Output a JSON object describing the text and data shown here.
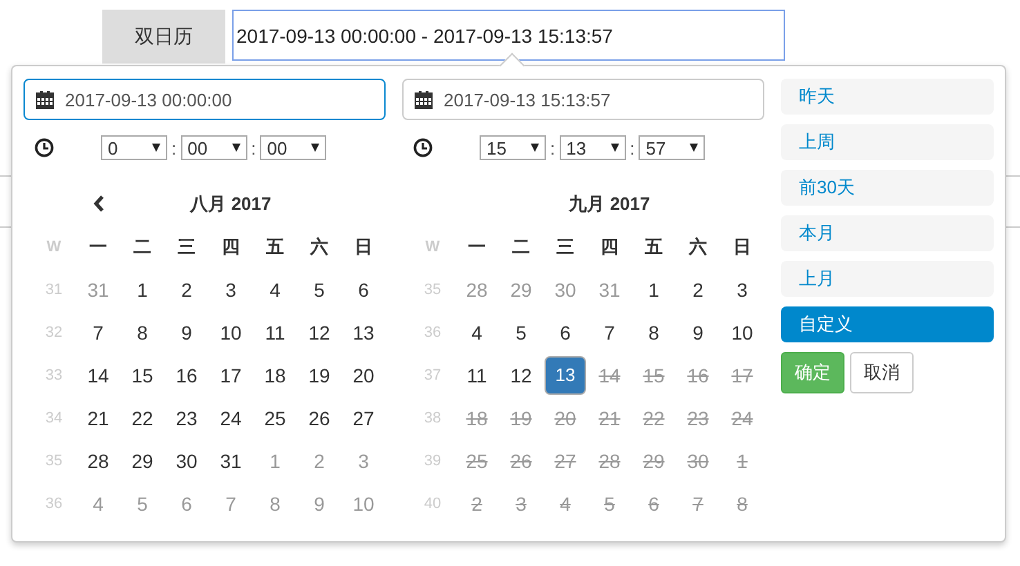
{
  "trigger": {
    "label": "双日历",
    "value": "2017-09-13 00:00:00 - 2017-09-13 15:13:57"
  },
  "calendars": [
    {
      "date_input": {
        "value": "2017-09-13 00:00:00",
        "focused": true
      },
      "time": {
        "hour": "0",
        "minute": "00",
        "second": "00",
        "separator": ":"
      },
      "has_prev": true,
      "month": "八月 2017",
      "week_header": "W",
      "weekdays": [
        "一",
        "二",
        "三",
        "四",
        "五",
        "六",
        "日"
      ],
      "weeks": [
        {
          "number": "31",
          "days": [
            {
              "text": "31",
              "kind": "muted"
            },
            {
              "text": "1",
              "kind": "normal"
            },
            {
              "text": "2",
              "kind": "normal"
            },
            {
              "text": "3",
              "kind": "normal"
            },
            {
              "text": "4",
              "kind": "normal"
            },
            {
              "text": "5",
              "kind": "normal"
            },
            {
              "text": "6",
              "kind": "normal"
            }
          ]
        },
        {
          "number": "32",
          "days": [
            {
              "text": "7",
              "kind": "normal"
            },
            {
              "text": "8",
              "kind": "normal"
            },
            {
              "text": "9",
              "kind": "normal"
            },
            {
              "text": "10",
              "kind": "normal"
            },
            {
              "text": "11",
              "kind": "normal"
            },
            {
              "text": "12",
              "kind": "normal"
            },
            {
              "text": "13",
              "kind": "normal"
            }
          ]
        },
        {
          "number": "33",
          "days": [
            {
              "text": "14",
              "kind": "normal"
            },
            {
              "text": "15",
              "kind": "normal"
            },
            {
              "text": "16",
              "kind": "normal"
            },
            {
              "text": "17",
              "kind": "normal"
            },
            {
              "text": "18",
              "kind": "normal"
            },
            {
              "text": "19",
              "kind": "normal"
            },
            {
              "text": "20",
              "kind": "normal"
            }
          ]
        },
        {
          "number": "34",
          "days": [
            {
              "text": "21",
              "kind": "normal"
            },
            {
              "text": "22",
              "kind": "normal"
            },
            {
              "text": "23",
              "kind": "normal"
            },
            {
              "text": "24",
              "kind": "normal"
            },
            {
              "text": "25",
              "kind": "normal"
            },
            {
              "text": "26",
              "kind": "normal"
            },
            {
              "text": "27",
              "kind": "normal"
            }
          ]
        },
        {
          "number": "35",
          "days": [
            {
              "text": "28",
              "kind": "normal"
            },
            {
              "text": "29",
              "kind": "normal"
            },
            {
              "text": "30",
              "kind": "normal"
            },
            {
              "text": "31",
              "kind": "normal"
            },
            {
              "text": "1",
              "kind": "muted"
            },
            {
              "text": "2",
              "kind": "muted"
            },
            {
              "text": "3",
              "kind": "muted"
            }
          ]
        },
        {
          "number": "36",
          "days": [
            {
              "text": "4",
              "kind": "muted"
            },
            {
              "text": "5",
              "kind": "muted"
            },
            {
              "text": "6",
              "kind": "muted"
            },
            {
              "text": "7",
              "kind": "muted"
            },
            {
              "text": "8",
              "kind": "muted"
            },
            {
              "text": "9",
              "kind": "muted"
            },
            {
              "text": "10",
              "kind": "muted"
            }
          ]
        }
      ]
    },
    {
      "date_input": {
        "value": "2017-09-13 15:13:57",
        "focused": false
      },
      "time": {
        "hour": "15",
        "minute": "13",
        "second": "57",
        "separator": ":"
      },
      "has_prev": false,
      "month": "九月 2017",
      "week_header": "W",
      "weekdays": [
        "一",
        "二",
        "三",
        "四",
        "五",
        "六",
        "日"
      ],
      "weeks": [
        {
          "number": "35",
          "days": [
            {
              "text": "28",
              "kind": "muted"
            },
            {
              "text": "29",
              "kind": "muted"
            },
            {
              "text": "30",
              "kind": "muted"
            },
            {
              "text": "31",
              "kind": "muted"
            },
            {
              "text": "1",
              "kind": "normal"
            },
            {
              "text": "2",
              "kind": "normal"
            },
            {
              "text": "3",
              "kind": "normal"
            }
          ]
        },
        {
          "number": "36",
          "days": [
            {
              "text": "4",
              "kind": "normal"
            },
            {
              "text": "5",
              "kind": "normal"
            },
            {
              "text": "6",
              "kind": "normal"
            },
            {
              "text": "7",
              "kind": "normal"
            },
            {
              "text": "8",
              "kind": "normal"
            },
            {
              "text": "9",
              "kind": "normal"
            },
            {
              "text": "10",
              "kind": "normal"
            }
          ]
        },
        {
          "number": "37",
          "days": [
            {
              "text": "11",
              "kind": "normal"
            },
            {
              "text": "12",
              "kind": "normal"
            },
            {
              "text": "13",
              "kind": "selected"
            },
            {
              "text": "14",
              "kind": "disabled"
            },
            {
              "text": "15",
              "kind": "disabled"
            },
            {
              "text": "16",
              "kind": "disabled"
            },
            {
              "text": "17",
              "kind": "disabled"
            }
          ]
        },
        {
          "number": "38",
          "days": [
            {
              "text": "18",
              "kind": "disabled"
            },
            {
              "text": "19",
              "kind": "disabled"
            },
            {
              "text": "20",
              "kind": "disabled"
            },
            {
              "text": "21",
              "kind": "disabled"
            },
            {
              "text": "22",
              "kind": "disabled"
            },
            {
              "text": "23",
              "kind": "disabled"
            },
            {
              "text": "24",
              "kind": "disabled"
            }
          ]
        },
        {
          "number": "39",
          "days": [
            {
              "text": "25",
              "kind": "disabled"
            },
            {
              "text": "26",
              "kind": "disabled"
            },
            {
              "text": "27",
              "kind": "disabled"
            },
            {
              "text": "28",
              "kind": "disabled"
            },
            {
              "text": "29",
              "kind": "disabled"
            },
            {
              "text": "30",
              "kind": "disabled"
            },
            {
              "text": "1",
              "kind": "disabled"
            }
          ]
        },
        {
          "number": "40",
          "days": [
            {
              "text": "2",
              "kind": "disabled"
            },
            {
              "text": "3",
              "kind": "disabled"
            },
            {
              "text": "4",
              "kind": "disabled"
            },
            {
              "text": "5",
              "kind": "disabled"
            },
            {
              "text": "6",
              "kind": "disabled"
            },
            {
              "text": "7",
              "kind": "disabled"
            },
            {
              "text": "8",
              "kind": "disabled"
            }
          ]
        }
      ]
    }
  ],
  "ranges": [
    {
      "label": "昨天",
      "selected": false
    },
    {
      "label": "上周",
      "selected": false
    },
    {
      "label": "前30天",
      "selected": false
    },
    {
      "label": "本月",
      "selected": false
    },
    {
      "label": "上月",
      "selected": false
    },
    {
      "label": "自定义",
      "selected": true
    }
  ],
  "apply": "确定",
  "cancel": "取消"
}
